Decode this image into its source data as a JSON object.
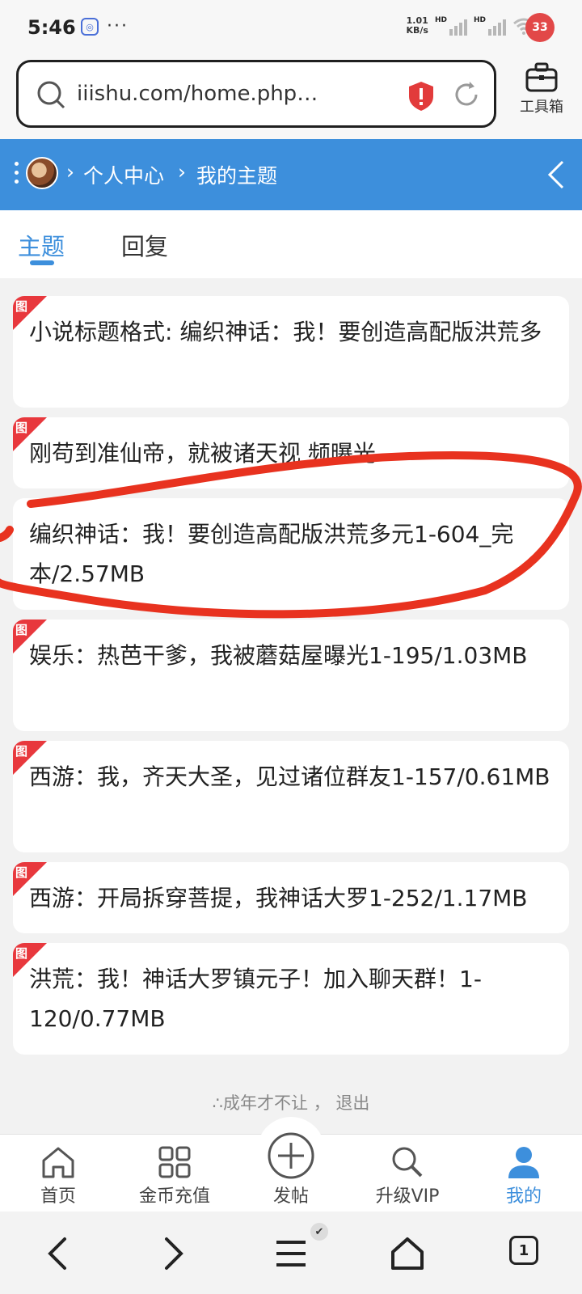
{
  "status_bar": {
    "time": "5:46",
    "speed_top": "1.01",
    "speed_bottom": "KB/s",
    "hd1": "HD",
    "hd2": "HD",
    "battery": "33",
    "dots": "···"
  },
  "browser": {
    "url": "iiishu.com/home.php?mod=s...",
    "toolbox_label": "工具箱"
  },
  "header": {
    "crumb1": "个人中心",
    "crumb2": "我的主题",
    "separator": "›"
  },
  "tabs": {
    "active": "主题",
    "inactive": "回复"
  },
  "badge_text": "图",
  "threads": [
    {
      "title": "小说标题格式: 编织神话：我！要创造高配版洪荒多",
      "has_badge": true
    },
    {
      "title": "刚苟到准仙帝，就被诸天视 频曝光",
      "has_badge": true
    },
    {
      "title": "编织神话：我！要创造高配版洪荒多元1-604_完本/2.57MB",
      "has_badge": false
    },
    {
      "title": "娱乐：热芭干爹，我被蘑菇屋曝光1-195/1.03MB",
      "has_badge": true
    },
    {
      "title": "西游：我，齐天大圣，见过诸位群友1-157/0.61MB",
      "has_badge": true
    },
    {
      "title": "西游：开局拆穿菩提，我神话大罗1-252/1.17MB",
      "has_badge": true
    },
    {
      "title": "洪荒：我！神话大罗镇元子！加入聊天群！1-120/0.77MB",
      "has_badge": true
    }
  ],
  "footer": {
    "note": "∴成年才不让 ， 退出"
  },
  "bottom_nav": {
    "items": [
      {
        "label": "首页",
        "icon": "home-icon"
      },
      {
        "label": "金币充值",
        "icon": "grid-icon"
      },
      {
        "label": "发帖",
        "icon": "plus-circle-icon"
      },
      {
        "label": "升级VIP",
        "icon": "search-icon"
      },
      {
        "label": "我的",
        "icon": "user-icon"
      }
    ]
  },
  "system_nav": {
    "tab_count": "1",
    "check": "✔"
  },
  "colors": {
    "accent": "#3d8fdc",
    "badge": "#e8383d",
    "annotation": "#e8321f"
  }
}
